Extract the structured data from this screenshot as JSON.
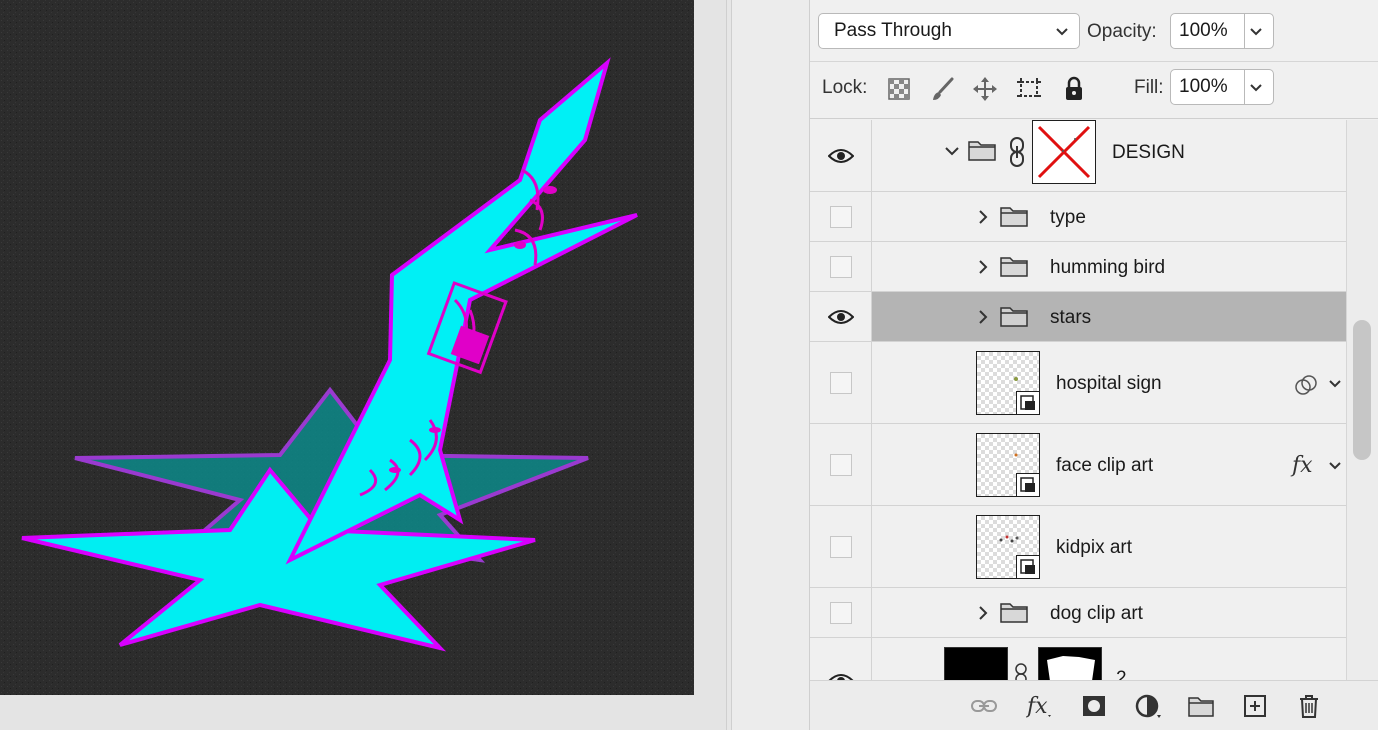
{
  "blend": {
    "mode": "Pass Through",
    "opacity_label": "Opacity:",
    "opacity_value": "100%"
  },
  "lock": {
    "lock_label": "Lock:",
    "fill_label": "Fill:",
    "fill_value": "100%"
  },
  "layers": [
    {
      "name": "DESIGN",
      "visible": true,
      "type": "group-with-mask"
    },
    {
      "name": "type",
      "visible": false,
      "type": "group"
    },
    {
      "name": "humming bird",
      "visible": false,
      "type": "group"
    },
    {
      "name": "stars",
      "visible": true,
      "type": "group",
      "selected": true
    },
    {
      "name": "hospital sign",
      "visible": false,
      "type": "smart-object",
      "badge": "blend-if-icon"
    },
    {
      "name": "face clip art",
      "visible": false,
      "type": "smart-object",
      "badge": "fx"
    },
    {
      "name": "kidpix art",
      "visible": false,
      "type": "smart-object"
    },
    {
      "name": "dog clip art",
      "visible": false,
      "type": "group"
    },
    {
      "name": "2",
      "visible": true,
      "type": "layer-with-mask"
    }
  ],
  "colors": {
    "canvas_bg": "#2a2a2a",
    "cyan": "#00f0f5",
    "magenta": "#d800ff",
    "selected_row": "#b4b4b4"
  }
}
